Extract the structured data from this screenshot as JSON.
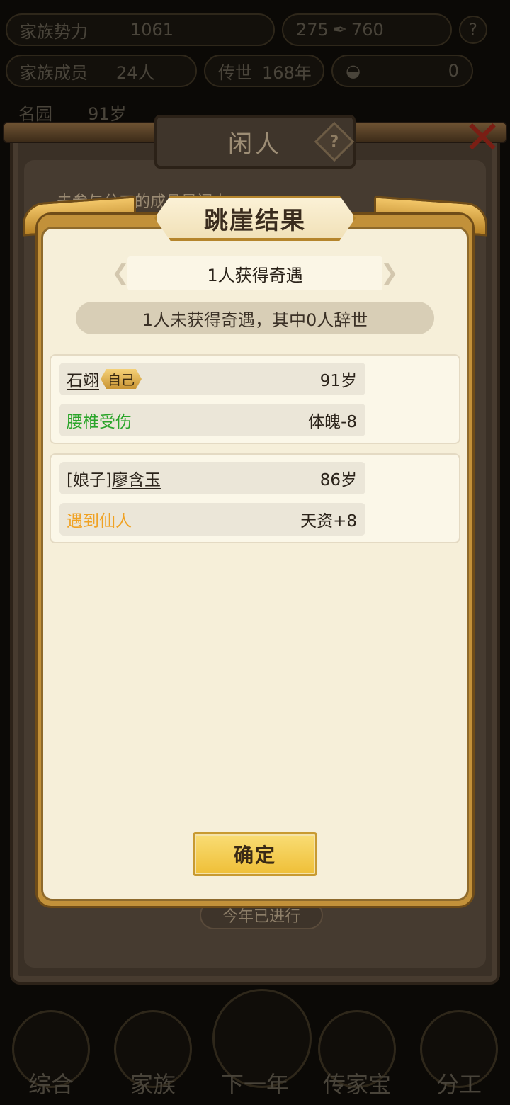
{
  "background": {
    "top_stats": {
      "family_power_label": "家族势力",
      "family_power_value": "1061",
      "currency_a": "275",
      "currency_b": "760",
      "members_label": "家族成员",
      "members_value": "24人",
      "generation_label": "传世",
      "generation_value": "168年",
      "coins_value": "0",
      "region_label": "名园",
      "region_value": "91岁"
    },
    "idle_panel": {
      "title": "闲人",
      "hint": "未参与分工的成员是闲人",
      "year_status": "今年已进行"
    },
    "bottom_nav": [
      "综合",
      "家族",
      "下一年",
      "传家宝",
      "分工"
    ]
  },
  "modal": {
    "title": "跳崖结果",
    "banner": "1人获得奇遇",
    "summary": "1人未获得奇遇，其中0人辞世",
    "results": [
      {
        "prefix": "",
        "name": "石翊",
        "tag": "自己",
        "age": "91岁",
        "event": "腰椎受伤",
        "event_type": "bad",
        "effect": "体魄-8"
      },
      {
        "prefix": "[娘子]",
        "name": "廖含玉",
        "tag": "",
        "age": "86岁",
        "event": "遇到仙人",
        "event_type": "good",
        "effect": "天资+8"
      }
    ],
    "confirm_label": "确定"
  }
}
